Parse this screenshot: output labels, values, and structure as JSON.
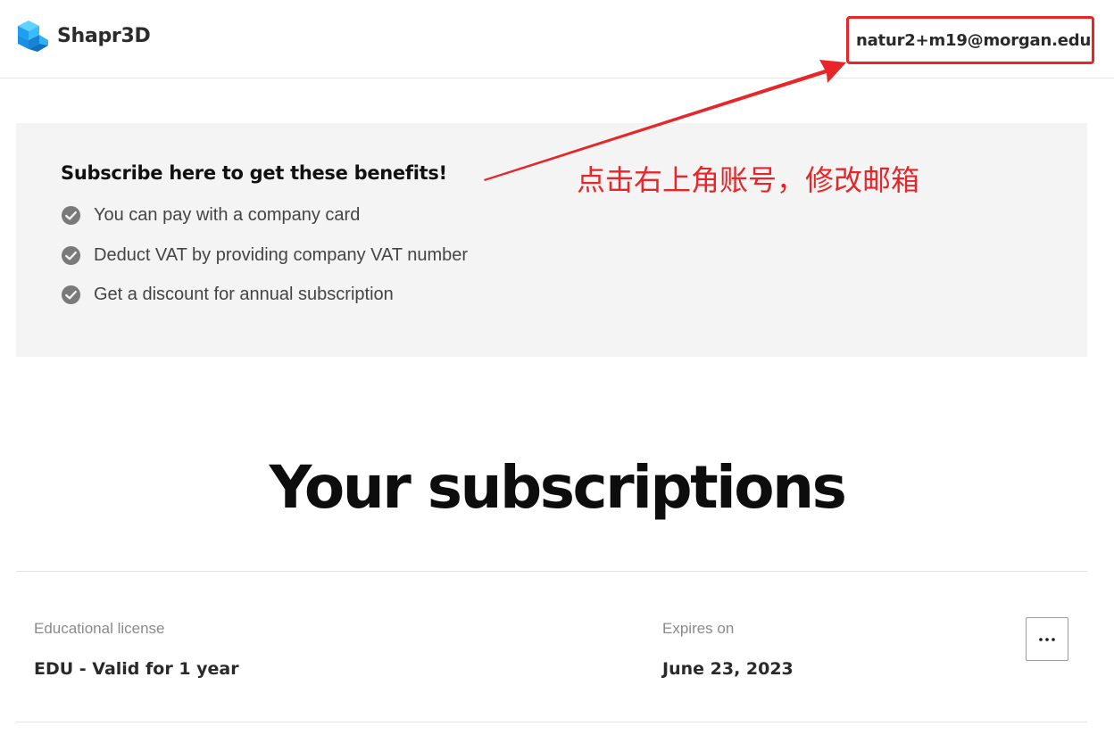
{
  "header": {
    "logo_text": "Shapr3D",
    "account_email": "natur2+m19@morgan.edu",
    "icons": [
      "shapr3d-logo-icon",
      "caret-down-icon"
    ]
  },
  "benefits": {
    "title": "Subscribe here to get these benefits!",
    "items": [
      {
        "label": "You can pay with a company card",
        "icon": "check-circle-icon"
      },
      {
        "label": "Deduct VAT by providing company VAT number",
        "icon": "check-circle-icon"
      },
      {
        "label": "Get a discount for annual subscription",
        "icon": "check-circle-icon"
      }
    ]
  },
  "annotation": {
    "text": "点击右上角账号，修改邮箱",
    "color": "#e8262a"
  },
  "subscriptions": {
    "title": "Your subscriptions",
    "items": [
      {
        "type_label": "Educational license",
        "type_value": "EDU - Valid for 1 year",
        "expires_label": "Expires on",
        "expires_value": "June 23, 2023",
        "menu_icon": "more-horizontal-icon"
      }
    ]
  },
  "colors": {
    "brand_blue": "#29a9f5",
    "annotation_red": "#e8262a",
    "panel_bg": "#f4f4f4",
    "check_gray": "#7a7a7a"
  }
}
